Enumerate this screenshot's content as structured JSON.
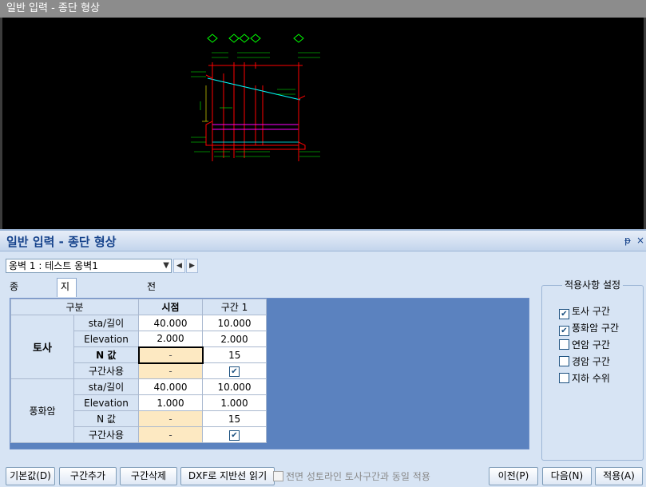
{
  "cad": {
    "title": "일반 입력 - 종단 형상"
  },
  "panel": {
    "title": "일반 입력 - 종단 형상",
    "pin": "ᵽ",
    "close": "×"
  },
  "wall_select": {
    "value": "옹벽 1 : 테스트 옹벽1",
    "prev": "◀",
    "next": "▶"
  },
  "tabs": [
    "종단 형상",
    "지반선/암선 정보",
    "전면 토사"
  ],
  "grid": {
    "header": {
      "group": "구분",
      "start": "시점",
      "section1": "구간 1"
    },
    "soil": {
      "label": "토사",
      "rows": [
        {
          "label": "sta/길이",
          "start": "40.000",
          "section1": "10.000"
        },
        {
          "label": "Elevation",
          "start": "2.000",
          "section1": "2.000"
        },
        {
          "label": "N 값",
          "start": "-",
          "section1": "15"
        },
        {
          "label": "구간사용",
          "start": "-",
          "section1": "✔"
        }
      ]
    },
    "weathered": {
      "label": "풍화암",
      "rows": [
        {
          "label": "sta/길이",
          "start": "40.000",
          "section1": "10.000"
        },
        {
          "label": "Elevation",
          "start": "1.000",
          "section1": "1.000"
        },
        {
          "label": "N 값",
          "start": "-",
          "section1": "15"
        },
        {
          "label": "구간사용",
          "start": "-",
          "section1": "✔"
        }
      ]
    }
  },
  "options": {
    "title": "적용사항 설정",
    "items": [
      {
        "label": "토사 구간",
        "checked": "✔"
      },
      {
        "label": "풍화암 구간",
        "checked": "✔"
      },
      {
        "label": "연암 구간",
        "checked": ""
      },
      {
        "label": "경암 구간",
        "checked": ""
      },
      {
        "label": "지하 수위",
        "checked": ""
      }
    ]
  },
  "buttons": {
    "default": "기본값(D)",
    "add": "구간추가",
    "delete": "구간삭제",
    "dxf": "DXF로 지반선 읽기",
    "same_as_front": "전면 성토라인 토사구간과 동일 적용",
    "prev": "이전(P)",
    "next": "다음(N)",
    "apply": "적용(A)"
  },
  "colors": {
    "soil_line": "#00ffff",
    "ground_line": "#ff00ff",
    "dimension": "#ff0000",
    "label": "#00ff00"
  }
}
